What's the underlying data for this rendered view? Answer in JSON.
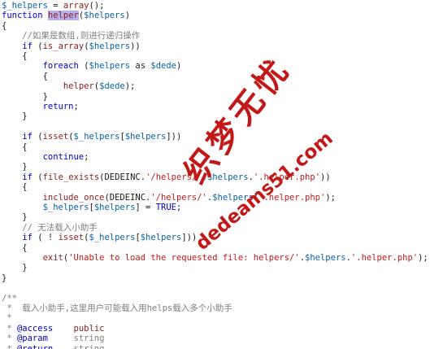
{
  "code_lines": [
    [
      {
        "t": "$_helpers",
        "c": "var"
      },
      {
        "t": " = ",
        "c": "plain"
      },
      {
        "t": "array",
        "c": "fn"
      },
      {
        "t": "();",
        "c": "plain"
      }
    ],
    [
      {
        "t": "function",
        "c": "kw"
      },
      {
        "t": " ",
        "c": "plain"
      },
      {
        "t": "helper",
        "c": "hl"
      },
      {
        "t": "(",
        "c": "plain"
      },
      {
        "t": "$helpers",
        "c": "var"
      },
      {
        "t": ")",
        "c": "plain"
      }
    ],
    [
      {
        "t": "{",
        "c": "plain"
      }
    ],
    [
      {
        "t": "    //如果是数组,则进行递归操作",
        "c": "com"
      }
    ],
    [
      {
        "t": "    ",
        "c": "plain"
      },
      {
        "t": "if",
        "c": "kw"
      },
      {
        "t": " (",
        "c": "plain"
      },
      {
        "t": "is_array",
        "c": "fn"
      },
      {
        "t": "(",
        "c": "plain"
      },
      {
        "t": "$helpers",
        "c": "var"
      },
      {
        "t": "))",
        "c": "plain"
      }
    ],
    [
      {
        "t": "    {",
        "c": "plain"
      }
    ],
    [
      {
        "t": "        ",
        "c": "plain"
      },
      {
        "t": "foreach",
        "c": "kw"
      },
      {
        "t": " (",
        "c": "plain"
      },
      {
        "t": "$helpers",
        "c": "var"
      },
      {
        "t": " as ",
        "c": "plain"
      },
      {
        "t": "$dede",
        "c": "var"
      },
      {
        "t": ")",
        "c": "plain"
      }
    ],
    [
      {
        "t": "        {",
        "c": "plain"
      }
    ],
    [
      {
        "t": "            ",
        "c": "plain"
      },
      {
        "t": "helper",
        "c": "fn"
      },
      {
        "t": "(",
        "c": "plain"
      },
      {
        "t": "$dede",
        "c": "var"
      },
      {
        "t": ");",
        "c": "plain"
      }
    ],
    [
      {
        "t": "        }",
        "c": "plain"
      }
    ],
    [
      {
        "t": "        ",
        "c": "plain"
      },
      {
        "t": "return",
        "c": "kw"
      },
      {
        "t": ";",
        "c": "plain"
      }
    ],
    [
      {
        "t": "    }",
        "c": "plain"
      }
    ],
    [
      {
        "t": "",
        "c": "plain"
      }
    ],
    [
      {
        "t": "    ",
        "c": "plain"
      },
      {
        "t": "if",
        "c": "kw"
      },
      {
        "t": " (",
        "c": "plain"
      },
      {
        "t": "isset",
        "c": "fn"
      },
      {
        "t": "(",
        "c": "plain"
      },
      {
        "t": "$_helpers",
        "c": "var"
      },
      {
        "t": "[",
        "c": "plain"
      },
      {
        "t": "$helpers",
        "c": "var"
      },
      {
        "t": "]))",
        "c": "plain"
      }
    ],
    [
      {
        "t": "    {",
        "c": "plain"
      }
    ],
    [
      {
        "t": "        ",
        "c": "plain"
      },
      {
        "t": "continue",
        "c": "kw"
      },
      {
        "t": ";",
        "c": "plain"
      }
    ],
    [
      {
        "t": "    }",
        "c": "plain"
      }
    ],
    [
      {
        "t": "    ",
        "c": "plain"
      },
      {
        "t": "if",
        "c": "kw"
      },
      {
        "t": " (",
        "c": "plain"
      },
      {
        "t": "file_exists",
        "c": "fn"
      },
      {
        "t": "(DEDEINC.",
        "c": "plain"
      },
      {
        "t": "'/helpers/'",
        "c": "str"
      },
      {
        "t": ".",
        "c": "plain"
      },
      {
        "t": "$helpers",
        "c": "var"
      },
      {
        "t": ".",
        "c": "plain"
      },
      {
        "t": "'.helper.php'",
        "c": "str"
      },
      {
        "t": "))",
        "c": "plain"
      }
    ],
    [
      {
        "t": "    {",
        "c": "plain"
      }
    ],
    [
      {
        "t": "        ",
        "c": "plain"
      },
      {
        "t": "include_once",
        "c": "fn"
      },
      {
        "t": "(DEDEINC.",
        "c": "plain"
      },
      {
        "t": "'/helpers/'",
        "c": "str"
      },
      {
        "t": ".",
        "c": "plain"
      },
      {
        "t": "$helpers",
        "c": "var"
      },
      {
        "t": ".",
        "c": "plain"
      },
      {
        "t": "'.helper.php'",
        "c": "str"
      },
      {
        "t": ");",
        "c": "plain"
      }
    ],
    [
      {
        "t": "        ",
        "c": "plain"
      },
      {
        "t": "$_helpers",
        "c": "var"
      },
      {
        "t": "[",
        "c": "plain"
      },
      {
        "t": "$helpers",
        "c": "var"
      },
      {
        "t": "] = ",
        "c": "plain"
      },
      {
        "t": "TRUE",
        "c": "kw"
      },
      {
        "t": ";",
        "c": "plain"
      }
    ],
    [
      {
        "t": "    }",
        "c": "plain"
      }
    ],
    [
      {
        "t": "    // 无法载入小助手",
        "c": "com"
      }
    ],
    [
      {
        "t": "    ",
        "c": "plain"
      },
      {
        "t": "if",
        "c": "kw"
      },
      {
        "t": " ( ! ",
        "c": "plain"
      },
      {
        "t": "isset",
        "c": "fn"
      },
      {
        "t": "(",
        "c": "plain"
      },
      {
        "t": "$_helpers",
        "c": "var"
      },
      {
        "t": "[",
        "c": "plain"
      },
      {
        "t": "$helpers",
        "c": "var"
      },
      {
        "t": "]))",
        "c": "plain"
      }
    ],
    [
      {
        "t": "    {",
        "c": "plain"
      }
    ],
    [
      {
        "t": "        ",
        "c": "plain"
      },
      {
        "t": "exit",
        "c": "fn"
      },
      {
        "t": "(",
        "c": "plain"
      },
      {
        "t": "'Unable to load the requested file: helpers/'",
        "c": "str"
      },
      {
        "t": ".",
        "c": "plain"
      },
      {
        "t": "$helpers",
        "c": "var"
      },
      {
        "t": ".",
        "c": "plain"
      },
      {
        "t": "'.helper.php'",
        "c": "str"
      },
      {
        "t": ");",
        "c": "plain"
      }
    ],
    [
      {
        "t": "    }",
        "c": "plain"
      }
    ],
    [
      {
        "t": "}",
        "c": "plain"
      }
    ],
    [
      {
        "t": "",
        "c": "plain"
      }
    ],
    [
      {
        "t": "/**",
        "c": "com"
      }
    ],
    [
      {
        "t": " *  载入小助手,这里用户可能载入用helps载入多个小助手",
        "c": "com"
      }
    ],
    [
      {
        "t": " *",
        "c": "com"
      }
    ],
    [
      {
        "t": " * ",
        "c": "com"
      },
      {
        "t": "@access",
        "c": "kw"
      },
      {
        "t": "    ",
        "c": "com"
      },
      {
        "t": "public",
        "c": "fn"
      }
    ],
    [
      {
        "t": " * ",
        "c": "com"
      },
      {
        "t": "@param",
        "c": "kw"
      },
      {
        "t": "     string",
        "c": "com"
      }
    ],
    [
      {
        "t": " * ",
        "c": "com"
      },
      {
        "t": "@return",
        "c": "kw"
      },
      {
        "t": "    string",
        "c": "com"
      }
    ]
  ],
  "watermark": {
    "chinese": "织梦无忧",
    "url": "dedeams51.com"
  },
  "colors": {
    "background": "#ffffff",
    "keyword": "#0000c8",
    "function": "#8b2020",
    "variable": "#0a60a8",
    "string": "#c51a1a",
    "comment": "#7f7f7f",
    "highlight": "#b9b0ef",
    "watermark": "#c21818"
  }
}
